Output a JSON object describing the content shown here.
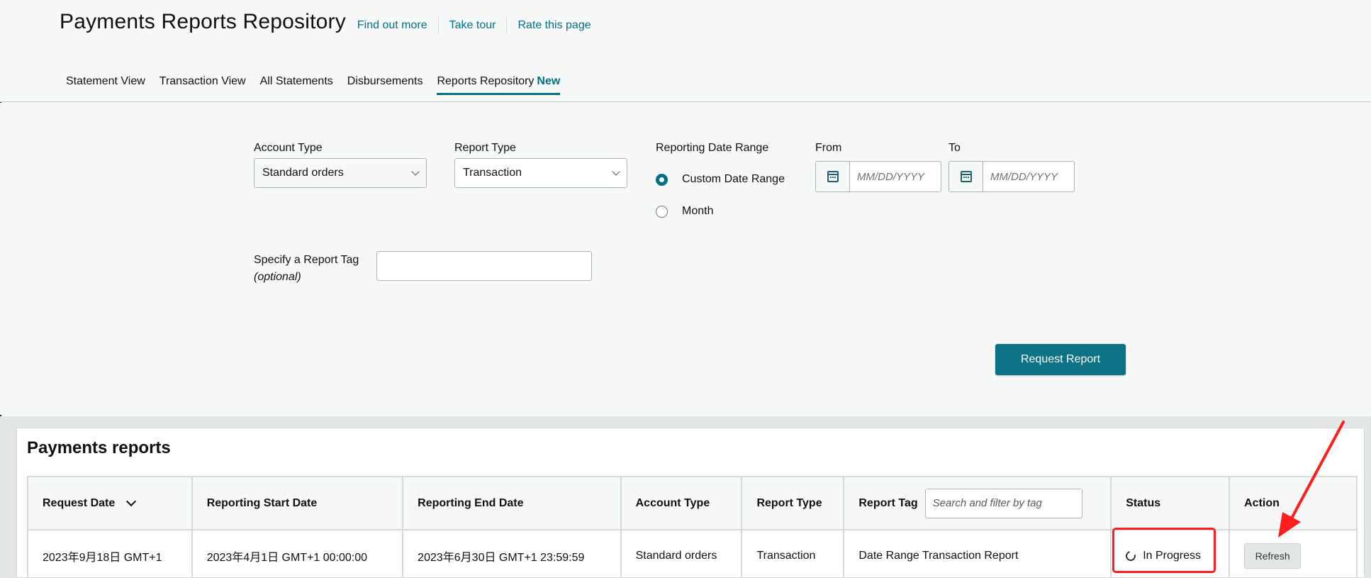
{
  "header": {
    "title": "Payments Reports Repository",
    "links": [
      "Find out more",
      "Take tour",
      "Rate this page"
    ]
  },
  "tabs": [
    {
      "label": "Statement View"
    },
    {
      "label": "Transaction View"
    },
    {
      "label": "All Statements"
    },
    {
      "label": "Disbursements"
    },
    {
      "label": "Reports Repository",
      "badge": "New",
      "active": true
    }
  ],
  "form": {
    "account_type": {
      "label": "Account Type",
      "value": "Standard orders"
    },
    "report_type": {
      "label": "Report Type",
      "value": "Transaction"
    },
    "date_range": {
      "label": "Reporting Date Range",
      "options": [
        {
          "label": "Custom Date Range",
          "checked": true
        },
        {
          "label": "Month",
          "checked": false
        }
      ]
    },
    "from": {
      "label": "From",
      "placeholder": "MM/DD/YYYY"
    },
    "to": {
      "label": "To",
      "placeholder": "MM/DD/YYYY"
    },
    "report_tag": {
      "label": "Specify a Report Tag",
      "optional": "(optional)"
    },
    "submit_label": "Request Report"
  },
  "reports": {
    "title": "Payments reports",
    "columns": [
      "Request Date",
      "Reporting Start Date",
      "Reporting End Date",
      "Account Type",
      "Report Type",
      "Report Tag",
      "Status",
      "Action"
    ],
    "tag_search_placeholder": "Search and filter by tag",
    "rows": [
      {
        "request_date": "2023年9月18日 GMT+1",
        "start_date": "2023年4月1日 GMT+1 00:00:00",
        "end_date": "2023年6月30日 GMT+1 23:59:59",
        "account_type": "Standard orders",
        "report_type": "Transaction",
        "report_tag": "Date Range Transaction Report",
        "status": "In Progress",
        "action": "Refresh"
      }
    ]
  },
  "colors": {
    "accent": "#007185",
    "button": "#0e7285",
    "annotation": "#ff1e1e"
  }
}
